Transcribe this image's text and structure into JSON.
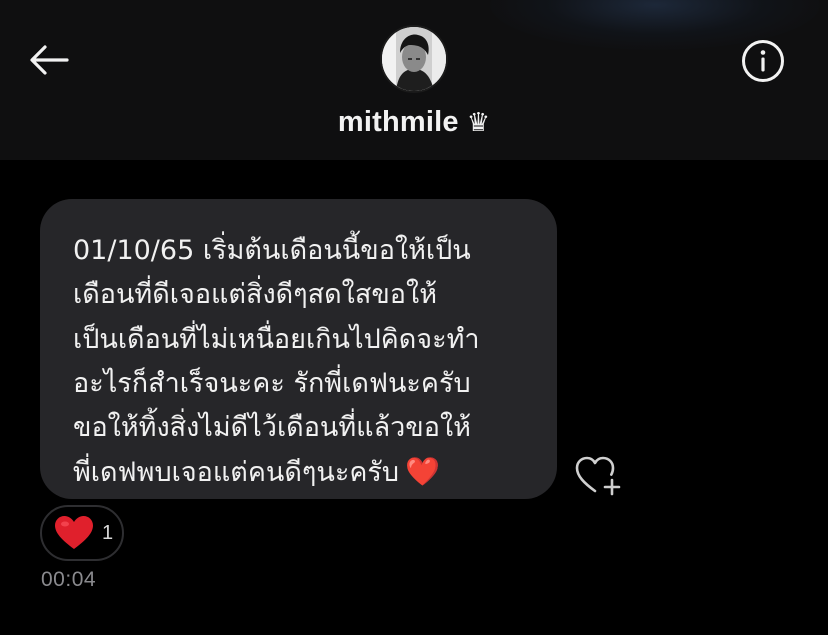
{
  "header": {
    "username": "mithmile",
    "verified_glyph": "♛",
    "back_icon": "arrow-left-icon",
    "info_icon": "info-circle-icon"
  },
  "message": {
    "lines": [
      "01/10/65 เริ่มต้นเดือนนี้ขอให้เป็น",
      "เดือนที่ดีเจอแต่สิ่งดีๆสดใสขอให้",
      "เป็นเดือนที่ไม่เหนื่อยเกินไปคิดจะทำ",
      "อะไรก็สำเร็จนะคะ รักพี่เดฟนะครับ",
      "ขอให้ทิ้งสิ่งไม่ดีไว้เดือนที่แล้วขอให้",
      "พี่เดฟพบเจอแต่คนดีๆนะครับ"
    ],
    "emoji": "❤️"
  },
  "reaction": {
    "icon": "red-heart-icon",
    "count": "1"
  },
  "timestamp": "00:04",
  "colors": {
    "background": "#000000",
    "header": "#0f0f10",
    "bubble": "#262629",
    "heart": "#e0202c"
  }
}
